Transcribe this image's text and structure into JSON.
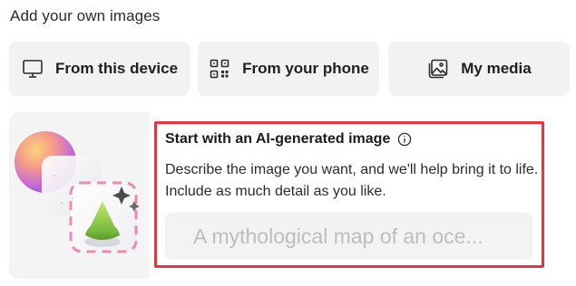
{
  "section_title": "Add your own images",
  "sources": [
    {
      "label": "From this device",
      "icon": "monitor-icon"
    },
    {
      "label": "From your phone",
      "icon": "qr-code-icon"
    },
    {
      "label": "My media",
      "icon": "image-gallery-icon"
    }
  ],
  "ai_card": {
    "title": "Start with an AI-generated image",
    "info_icon": "info-icon",
    "description": "Describe the image you want, and we'll help bring it to life. Include as much detail as you like.",
    "placeholder": "A mythological map of an oce..."
  },
  "colors": {
    "highlight_border": "#e0383e",
    "button_bg": "#f2f2f2",
    "input_bg": "#f3f3f3",
    "placeholder_text": "#bdbdbd"
  }
}
